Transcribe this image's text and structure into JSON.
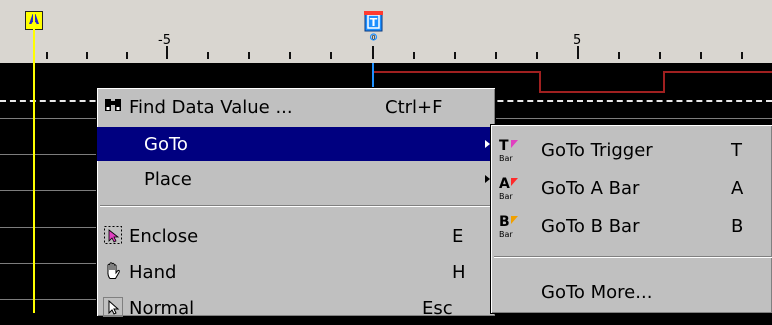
{
  "ruler": {
    "tick_labels": [
      "-5",
      "0",
      "5"
    ],
    "marker_a_label": "A",
    "marker_t_label": "T"
  },
  "context_menu": {
    "items": [
      {
        "label": "Find Data Value ...",
        "accel": "Ctrl+F",
        "icon": "binoculars-icon"
      },
      {
        "label": "GoTo",
        "submenu": true,
        "highlighted": true
      },
      {
        "label": "Place",
        "submenu": true
      },
      {
        "label": "Enclose",
        "accel": "E",
        "icon": "enclose-icon"
      },
      {
        "label": "Hand",
        "accel": "H",
        "icon": "hand-icon"
      },
      {
        "label": "Normal",
        "accel": "Esc",
        "icon": "pointer-icon"
      }
    ]
  },
  "goto_submenu": {
    "items": [
      {
        "label": "GoTo Trigger",
        "accel": "T",
        "icon": "goto-trigger-icon"
      },
      {
        "label": "GoTo A Bar",
        "accel": "A",
        "icon": "goto-a-bar-icon"
      },
      {
        "label": "GoTo B Bar",
        "accel": "B",
        "icon": "goto-b-bar-icon"
      },
      {
        "label": "GoTo More..."
      }
    ]
  },
  "colors": {
    "menu_bg": "#c0c0c0",
    "highlight": "#000080",
    "signal": "#a02020",
    "cursor_a": "#ffff00",
    "cursor_t": "#1e90ff"
  }
}
